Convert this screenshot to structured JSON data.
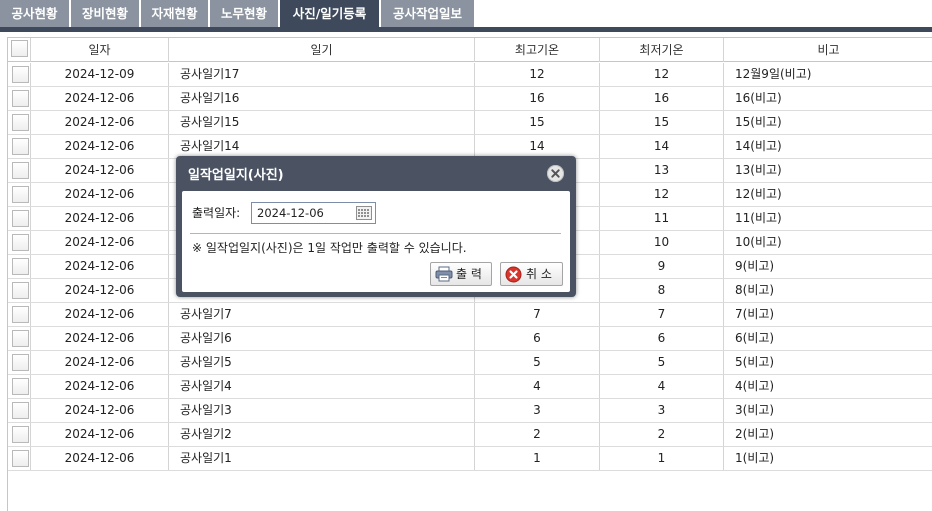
{
  "tabs": [
    {
      "label": "공사현황",
      "active": false
    },
    {
      "label": "장비현황",
      "active": false
    },
    {
      "label": "자재현황",
      "active": false
    },
    {
      "label": "노무현황",
      "active": false
    },
    {
      "label": "사진/일기등록",
      "active": true
    },
    {
      "label": "공사작업일보",
      "active": false
    }
  ],
  "grid": {
    "headers": {
      "date": "일자",
      "diary": "일기",
      "high": "최고기온",
      "low": "최저기온",
      "note": "비고"
    },
    "rows": [
      {
        "date": "2024-12-09",
        "diary": "공사일기17",
        "high": "12",
        "low": "12",
        "note": "12월9일(비고)"
      },
      {
        "date": "2024-12-06",
        "diary": "공사일기16",
        "high": "16",
        "low": "16",
        "note": "16(비고)"
      },
      {
        "date": "2024-12-06",
        "diary": "공사일기15",
        "high": "15",
        "low": "15",
        "note": "15(비고)"
      },
      {
        "date": "2024-12-06",
        "diary": "공사일기14",
        "high": "14",
        "low": "14",
        "note": "14(비고)"
      },
      {
        "date": "2024-12-06",
        "diary": "",
        "high": "",
        "low": "13",
        "note": "13(비고)"
      },
      {
        "date": "2024-12-06",
        "diary": "",
        "high": "",
        "low": "12",
        "note": "12(비고)"
      },
      {
        "date": "2024-12-06",
        "diary": "",
        "high": "",
        "low": "11",
        "note": "11(비고)"
      },
      {
        "date": "2024-12-06",
        "diary": "",
        "high": "",
        "low": "10",
        "note": "10(비고)"
      },
      {
        "date": "2024-12-06",
        "diary": "",
        "high": "",
        "low": "9",
        "note": "9(비고)"
      },
      {
        "date": "2024-12-06",
        "diary": "",
        "high": "",
        "low": "8",
        "note": "8(비고)"
      },
      {
        "date": "2024-12-06",
        "diary": "공사일기7",
        "high": "7",
        "low": "7",
        "note": "7(비고)"
      },
      {
        "date": "2024-12-06",
        "diary": "공사일기6",
        "high": "6",
        "low": "6",
        "note": "6(비고)"
      },
      {
        "date": "2024-12-06",
        "diary": "공사일기5",
        "high": "5",
        "low": "5",
        "note": "5(비고)"
      },
      {
        "date": "2024-12-06",
        "diary": "공사일기4",
        "high": "4",
        "low": "4",
        "note": "4(비고)"
      },
      {
        "date": "2024-12-06",
        "diary": "공사일기3",
        "high": "3",
        "low": "3",
        "note": "3(비고)"
      },
      {
        "date": "2024-12-06",
        "diary": "공사일기2",
        "high": "2",
        "low": "2",
        "note": "2(비고)"
      },
      {
        "date": "2024-12-06",
        "diary": "공사일기1",
        "high": "1",
        "low": "1",
        "note": "1(비고)"
      }
    ]
  },
  "dialog": {
    "title": "일작업일지(사진)",
    "date_label": "출력일자:",
    "date_value": "2024-12-06",
    "notice": "※ 일작업일지(사진)은 1일 작업만 출력할 수 있습니다.",
    "print_label": "출 력",
    "cancel_label": "취 소"
  },
  "colors": {
    "tab_bg": "#8a939f",
    "tab_active_bg": "#3e4a5c",
    "dialog_bg": "#4b5363",
    "cancel_icon": "#d9352c"
  },
  "icons": [
    "checkbox",
    "close-icon",
    "calendar-icon",
    "printer-icon",
    "cancel-icon"
  ]
}
